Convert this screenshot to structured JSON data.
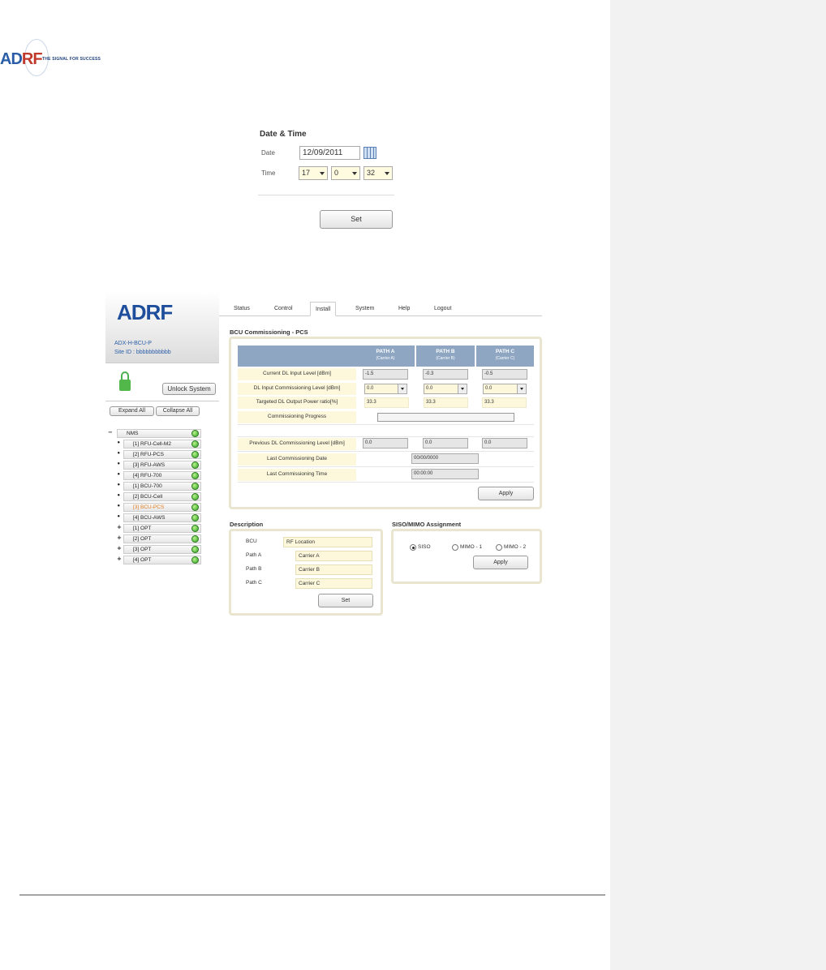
{
  "doc_header": {
    "brand_left": "AD",
    "brand_right": "RF",
    "tagline": "THE SIGNAL FOR SUCCESS"
  },
  "datetime": {
    "title": "Date & Time",
    "date_label": "Date",
    "date_value": "12/09/2011",
    "time_label": "Time",
    "hour": "17",
    "minute": "0",
    "second": "32",
    "set_label": "Set"
  },
  "app": {
    "brand": "ADRF",
    "model": "ADX-H-BCU-P",
    "site_id": "Site ID : bbbbbbbbbbb",
    "unlock_label": "Unlock System",
    "expand_label": "Expand All",
    "collapse_label": "Collapse All",
    "tabs": [
      "Status",
      "Control",
      "Install",
      "System",
      "Help",
      "Logout"
    ],
    "active_tab": "Install",
    "tree": {
      "root": "NMS",
      "items": [
        {
          "mark": "•",
          "label": "[1] RFU-Cell-M2",
          "selected": false
        },
        {
          "mark": "•",
          "label": "[2] RFU-PCS",
          "selected": false
        },
        {
          "mark": "•",
          "label": "[3] RFU-AWS",
          "selected": false
        },
        {
          "mark": "•",
          "label": "[4] RFU-700",
          "selected": false
        },
        {
          "mark": "•",
          "label": "[1] BCU-700",
          "selected": false
        },
        {
          "mark": "•",
          "label": "[2] BCU-Cell",
          "selected": false
        },
        {
          "mark": "•",
          "label": "[3] BCU-PCS",
          "selected": true
        },
        {
          "mark": "•",
          "label": "[4] BCU-AWS",
          "selected": false
        },
        {
          "mark": "+",
          "label": "[1] OPT",
          "selected": false
        },
        {
          "mark": "+",
          "label": "[2] OPT",
          "selected": false
        },
        {
          "mark": "+",
          "label": "[3] OPT",
          "selected": false
        },
        {
          "mark": "+",
          "label": "[4] OPT",
          "selected": false
        }
      ]
    },
    "commissioning": {
      "title": "BCU Commissioning - PCS",
      "paths": [
        {
          "name": "PATH A",
          "carrier": "(Carrier A)"
        },
        {
          "name": "PATH B",
          "carrier": "(Carrier B)"
        },
        {
          "name": "PATH C",
          "carrier": "(Carrier C)"
        }
      ],
      "row_current_label": "Current DL Input Level [dBm]",
      "current_values": [
        "-1.5",
        "-0.3",
        "-0.5"
      ],
      "row_input_label": "DL Input Commissioning Level [dBm]",
      "input_values": [
        "0.0",
        "0.0",
        "0.0"
      ],
      "row_target_label": "Targeted DL Output Power ratio[%]",
      "target_values": [
        "33.3",
        "33.3",
        "33.3"
      ],
      "row_progress_label": "Commissioning Progress",
      "progress_fraction": 0,
      "row_previous_label": "Previous DL Commissioning Level [dBm]",
      "previous_values": [
        "0.0",
        "0.0",
        "0.0"
      ],
      "row_date_label": "Last Commissioning Date",
      "last_date": "00/00/0000",
      "row_time_label": "Last Commissioning Time",
      "last_time": "00:00:00",
      "apply_label": "Apply"
    },
    "description": {
      "title": "Description",
      "rows": [
        {
          "label": "BCU",
          "value": "RF Location"
        },
        {
          "label": "Path A",
          "value": "Carrier A"
        },
        {
          "label": "Path B",
          "value": "Carrier B"
        },
        {
          "label": "Path C",
          "value": "Carrier C"
        }
      ],
      "set_label": "Set"
    },
    "siso_mimo": {
      "title": "SISO/MIMO Assignment",
      "options": [
        "SISO",
        "MIMO - 1",
        "MIMO - 2"
      ],
      "selected": "SISO",
      "apply_label": "Apply"
    }
  }
}
